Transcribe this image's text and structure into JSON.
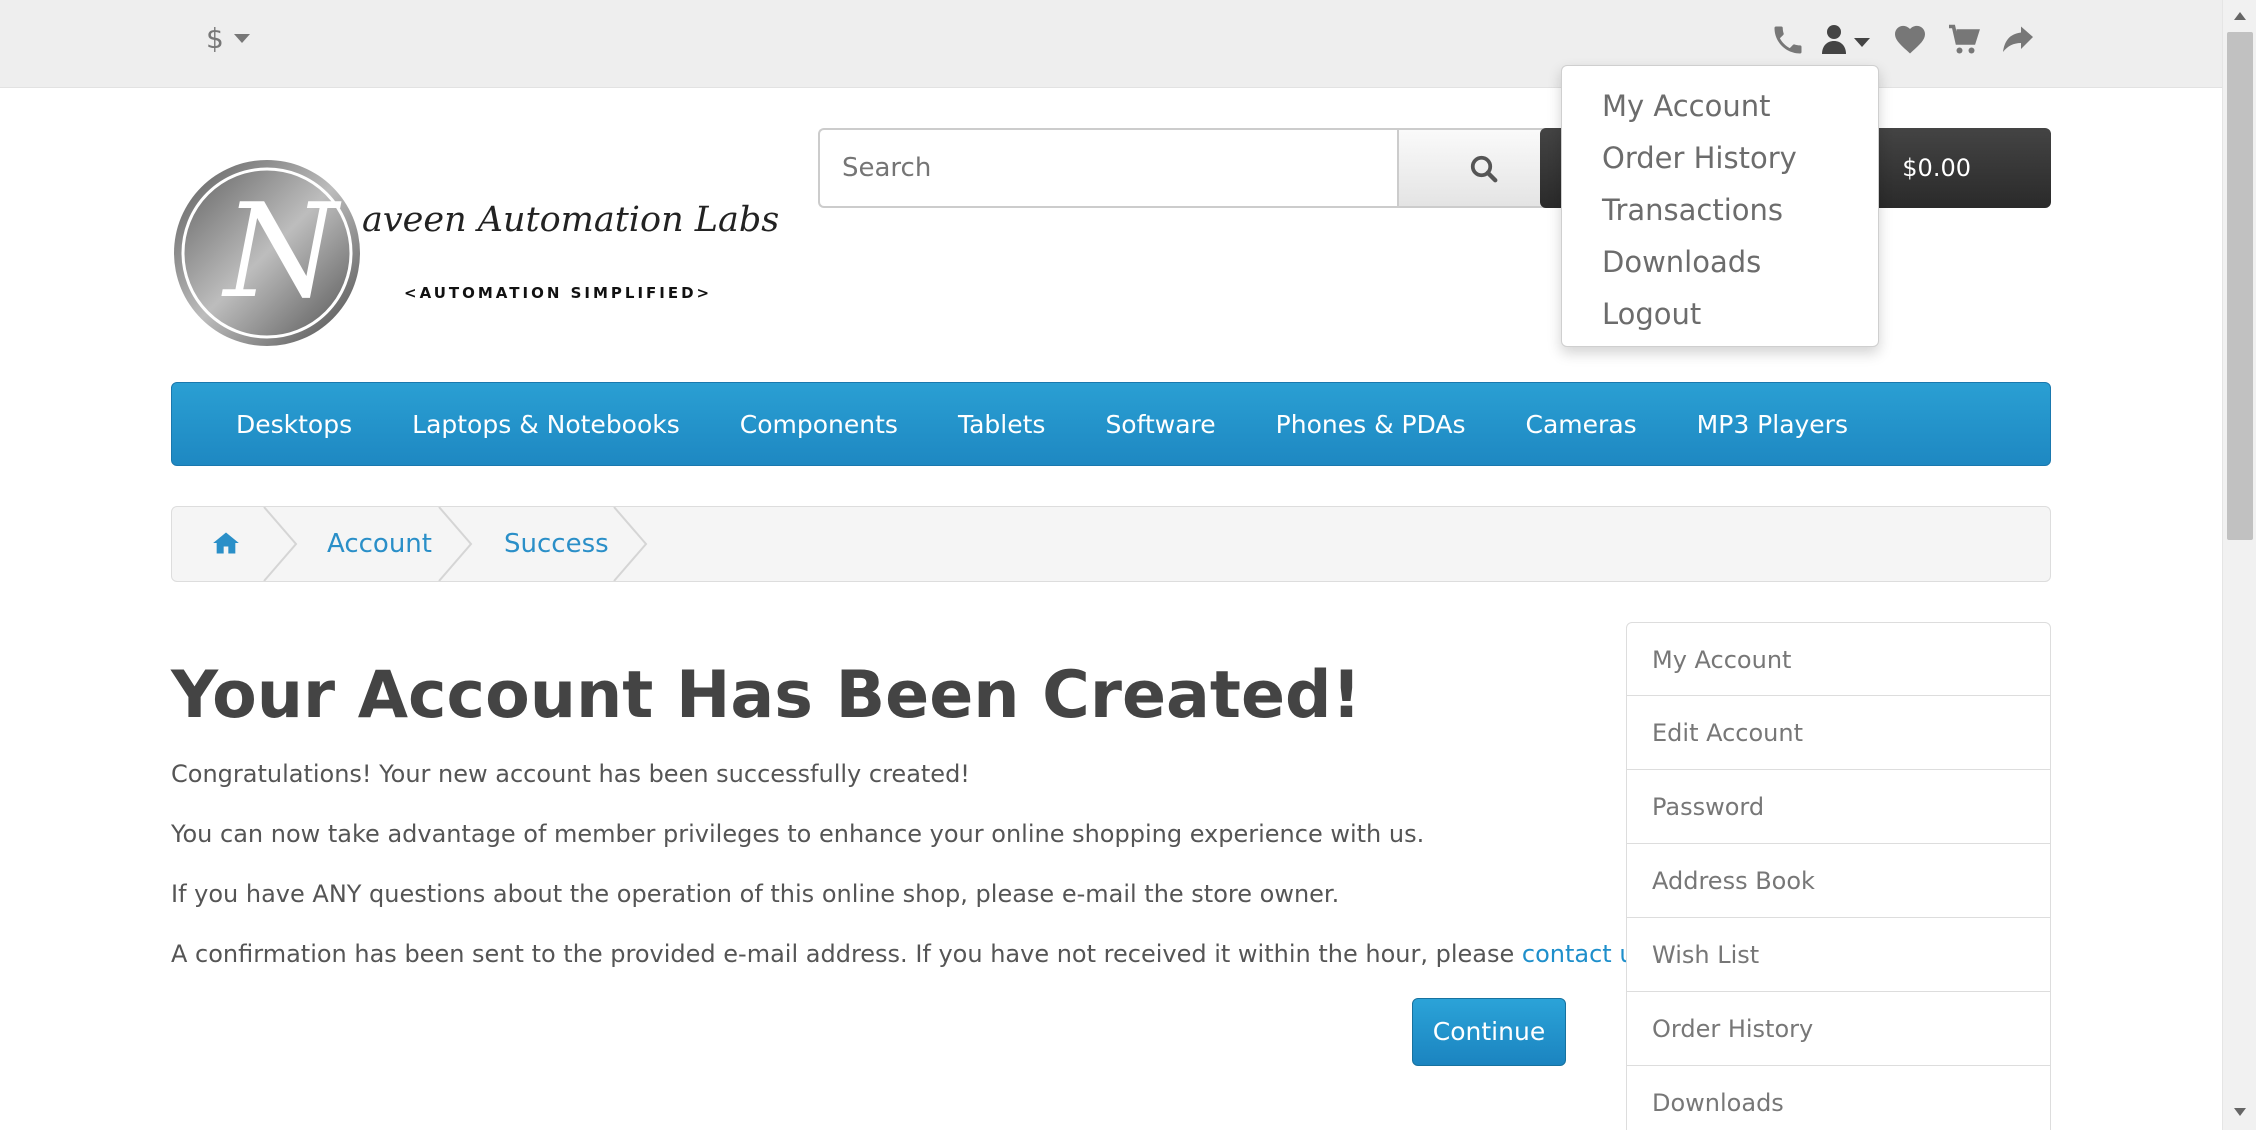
{
  "topbar": {
    "currency_symbol": "$",
    "icons": [
      "phone-icon",
      "user-icon",
      "heart-icon",
      "cart-icon",
      "share-icon"
    ]
  },
  "account_dropdown": {
    "items": [
      "My Account",
      "Order History",
      "Transactions",
      "Downloads",
      "Logout"
    ]
  },
  "header": {
    "logo_letter": "N",
    "logo_text": "aveen Automation Labs",
    "logo_tagline": "<AUTOMATION SIMPLIFIED>",
    "search_placeholder": "Search",
    "cart_total": "$0.00"
  },
  "menu": {
    "items": [
      "Desktops",
      "Laptops & Notebooks",
      "Components",
      "Tablets",
      "Software",
      "Phones & PDAs",
      "Cameras",
      "MP3 Players"
    ]
  },
  "breadcrumb": {
    "items": [
      "Account",
      "Success"
    ]
  },
  "content": {
    "title": "Your Account Has Been Created!",
    "p1": "Congratulations! Your new account has been successfully created!",
    "p2": "You can now take advantage of member privileges to enhance your online shopping experience with us.",
    "p3": "If you have ANY questions about the operation of this online shop, please e-mail the store owner.",
    "p4_before": "A confirmation has been sent to the provided e-mail address. If you have not received it within the hour, please ",
    "p4_link": "contact us",
    "p4_after": ".",
    "continue_label": "Continue"
  },
  "sidebar": {
    "items": [
      "My Account",
      "Edit Account",
      "Password",
      "Address Book",
      "Wish List",
      "Order History",
      "Downloads"
    ]
  },
  "colors": {
    "accent": "#229ac8",
    "dark_button": "#363636",
    "topbar": "#eeeeee"
  }
}
